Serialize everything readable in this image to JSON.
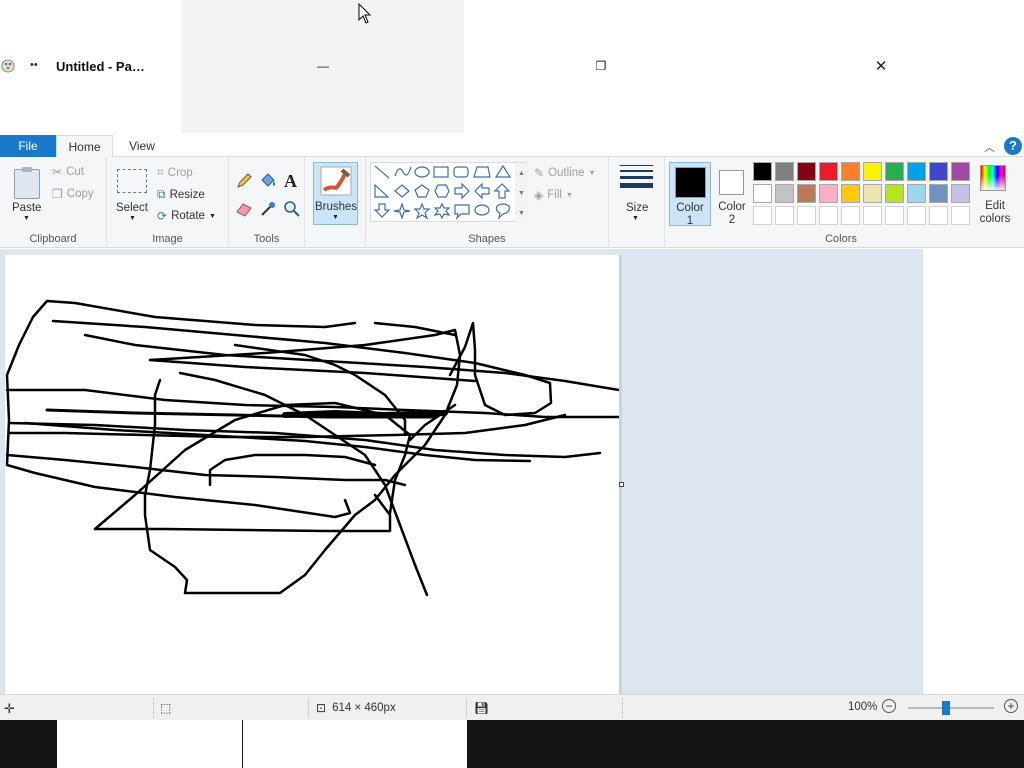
{
  "window": {
    "title": "Untitled - Pa…",
    "qat_symbol": "••",
    "minimize_symbol": "—",
    "restore_symbol": "❐",
    "close_symbol": "✕"
  },
  "ribbon": {
    "tabs": [
      {
        "label": "File"
      },
      {
        "label": "Home"
      },
      {
        "label": "View"
      }
    ],
    "collapse_symbol": "︿",
    "help_symbol": "?",
    "clipboard": {
      "paste": "Paste",
      "cut": "Cut",
      "copy": "Copy",
      "group_label": "Clipboard"
    },
    "image": {
      "select": "Select",
      "crop": "Crop",
      "resize": "Resize",
      "rotate": "Rotate",
      "group_label": "Image"
    },
    "tools": {
      "group_label": "Tools"
    },
    "brushes": {
      "label": "Brushes"
    },
    "shapes": {
      "outline": "Outline",
      "fill": "Fill",
      "group_label": "Shapes"
    },
    "size": {
      "label": "Size"
    },
    "colors": {
      "color1_line1": "Color",
      "color1_line2": "1",
      "color2_line1": "Color",
      "color2_line2": "2",
      "edit_line1": "Edit",
      "edit_line2": "colors",
      "group_label": "Colors",
      "palette_row1": [
        "#000000",
        "#7f7f7f",
        "#880015",
        "#ed1c24",
        "#ff7f27",
        "#fff200",
        "#22b14c",
        "#00a2e8",
        "#3f48cc",
        "#a349a4"
      ],
      "palette_row2": [
        "#ffffff",
        "#c3c3c3",
        "#b97a57",
        "#ffaec9",
        "#ffc90e",
        "#efe4b0",
        "#b5e61d",
        "#99d9ea",
        "#7092be",
        "#c8bfe7"
      ],
      "color1": "#000000",
      "color2": "#ffffff"
    }
  },
  "statusbar": {
    "dimensions": "614 × 460px",
    "zoom": "100%",
    "zoom_level_percent": 100
  }
}
